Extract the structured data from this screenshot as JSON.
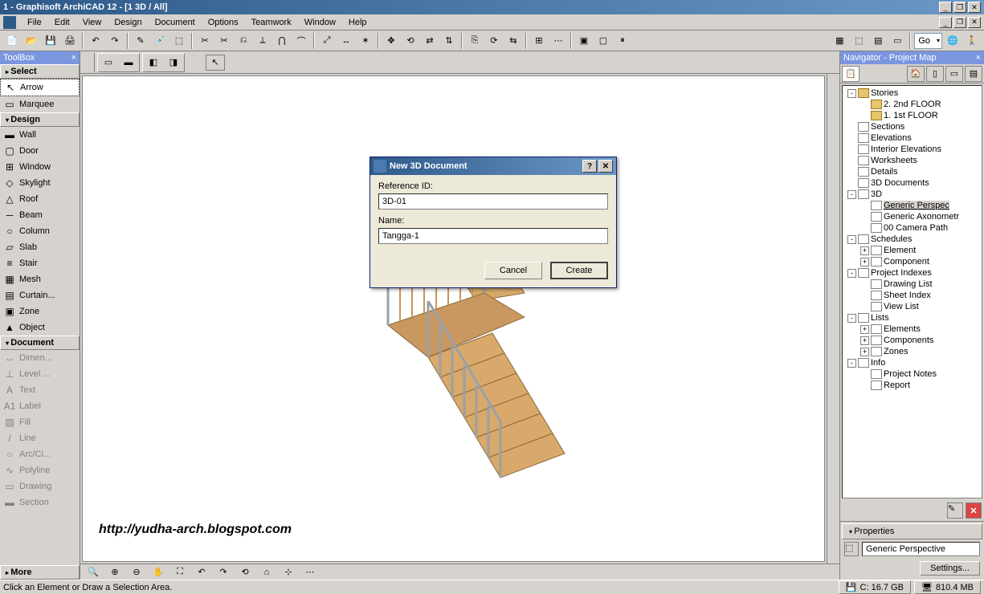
{
  "titlebar": {
    "title": "1 - Graphisoft ArchiCAD 12 - [1 3D / All]"
  },
  "menubar": {
    "items": [
      "File",
      "Edit",
      "View",
      "Design",
      "Document",
      "Options",
      "Teamwork",
      "Window",
      "Help"
    ]
  },
  "toolbar": {
    "go_label": "Go"
  },
  "toolbox": {
    "title": "ToolBox",
    "sections": {
      "select": "Select",
      "design": "Design",
      "document": "Document",
      "more": "More"
    },
    "select_items": [
      {
        "label": "Arrow",
        "icon": "↖",
        "selected": true
      },
      {
        "label": "Marquee",
        "icon": "▭"
      }
    ],
    "design_items": [
      {
        "label": "Wall",
        "icon": "▬"
      },
      {
        "label": "Door",
        "icon": "▢"
      },
      {
        "label": "Window",
        "icon": "⊞"
      },
      {
        "label": "Skylight",
        "icon": "◇"
      },
      {
        "label": "Roof",
        "icon": "△"
      },
      {
        "label": "Beam",
        "icon": "─"
      },
      {
        "label": "Column",
        "icon": "○"
      },
      {
        "label": "Slab",
        "icon": "▱"
      },
      {
        "label": "Stair",
        "icon": "≡"
      },
      {
        "label": "Mesh",
        "icon": "▦"
      },
      {
        "label": "Curtain...",
        "icon": "▤"
      },
      {
        "label": "Zone",
        "icon": "▣"
      },
      {
        "label": "Object",
        "icon": "▲"
      }
    ],
    "document_items": [
      {
        "label": "Dimen...",
        "icon": "↔"
      },
      {
        "label": "Level ...",
        "icon": "⊥"
      },
      {
        "label": "Text",
        "icon": "A"
      },
      {
        "label": "Label",
        "icon": "A1"
      },
      {
        "label": "Fill",
        "icon": "▨"
      },
      {
        "label": "Line",
        "icon": "/"
      },
      {
        "label": "Arc/Ci...",
        "icon": "○"
      },
      {
        "label": "Polyline",
        "icon": "∿"
      },
      {
        "label": "Drawing",
        "icon": "▭"
      },
      {
        "label": "Section",
        "icon": "▬"
      }
    ]
  },
  "navigator": {
    "title": "Navigator - Project Map",
    "tree": [
      {
        "d": 0,
        "t": "-",
        "i": "folder",
        "label": "Stories"
      },
      {
        "d": 1,
        "t": "",
        "i": "folder",
        "label": "2. 2nd FLOOR"
      },
      {
        "d": 1,
        "t": "",
        "i": "folder",
        "label": "1. 1st FLOOR"
      },
      {
        "d": 0,
        "t": "",
        "i": "doc",
        "label": "Sections"
      },
      {
        "d": 0,
        "t": "",
        "i": "doc",
        "label": "Elevations"
      },
      {
        "d": 0,
        "t": "",
        "i": "doc",
        "label": "Interior Elevations"
      },
      {
        "d": 0,
        "t": "",
        "i": "doc",
        "label": "Worksheets"
      },
      {
        "d": 0,
        "t": "",
        "i": "doc",
        "label": "Details"
      },
      {
        "d": 0,
        "t": "",
        "i": "doc",
        "label": "3D Documents"
      },
      {
        "d": 0,
        "t": "-",
        "i": "doc",
        "label": "3D"
      },
      {
        "d": 1,
        "t": "",
        "i": "doc",
        "label": "Generic Perspec",
        "selected": true
      },
      {
        "d": 1,
        "t": "",
        "i": "doc",
        "label": "Generic Axonometr"
      },
      {
        "d": 1,
        "t": "",
        "i": "doc",
        "label": "00 Camera Path"
      },
      {
        "d": 0,
        "t": "-",
        "i": "doc",
        "label": "Schedules"
      },
      {
        "d": 1,
        "t": "+",
        "i": "doc",
        "label": "Element"
      },
      {
        "d": 1,
        "t": "+",
        "i": "doc",
        "label": "Component"
      },
      {
        "d": 0,
        "t": "-",
        "i": "doc",
        "label": "Project Indexes"
      },
      {
        "d": 1,
        "t": "",
        "i": "doc",
        "label": "Drawing List"
      },
      {
        "d": 1,
        "t": "",
        "i": "doc",
        "label": "Sheet Index"
      },
      {
        "d": 1,
        "t": "",
        "i": "doc",
        "label": "View List"
      },
      {
        "d": 0,
        "t": "-",
        "i": "doc",
        "label": "Lists"
      },
      {
        "d": 1,
        "t": "+",
        "i": "doc",
        "label": "Elements"
      },
      {
        "d": 1,
        "t": "+",
        "i": "doc",
        "label": "Components"
      },
      {
        "d": 1,
        "t": "+",
        "i": "doc",
        "label": "Zones"
      },
      {
        "d": 0,
        "t": "-",
        "i": "doc",
        "label": "Info"
      },
      {
        "d": 1,
        "t": "",
        "i": "doc",
        "label": "Project Notes"
      },
      {
        "d": 1,
        "t": "",
        "i": "doc",
        "label": "Report"
      }
    ]
  },
  "properties": {
    "header": "Properties",
    "value": "Generic Perspective",
    "settings_btn": "Settings..."
  },
  "dialog": {
    "title": "New 3D Document",
    "ref_label": "Reference ID:",
    "ref_value": "3D-01",
    "name_label": "Name:",
    "name_value": "Tangga-1",
    "cancel": "Cancel",
    "create": "Create"
  },
  "statusbar": {
    "hint": "Click an Element or Draw a Selection Area.",
    "disk": "C: 16.7 GB",
    "mem": "810.4 MB"
  },
  "watermark": "http://yudha-arch.blogspot.com"
}
